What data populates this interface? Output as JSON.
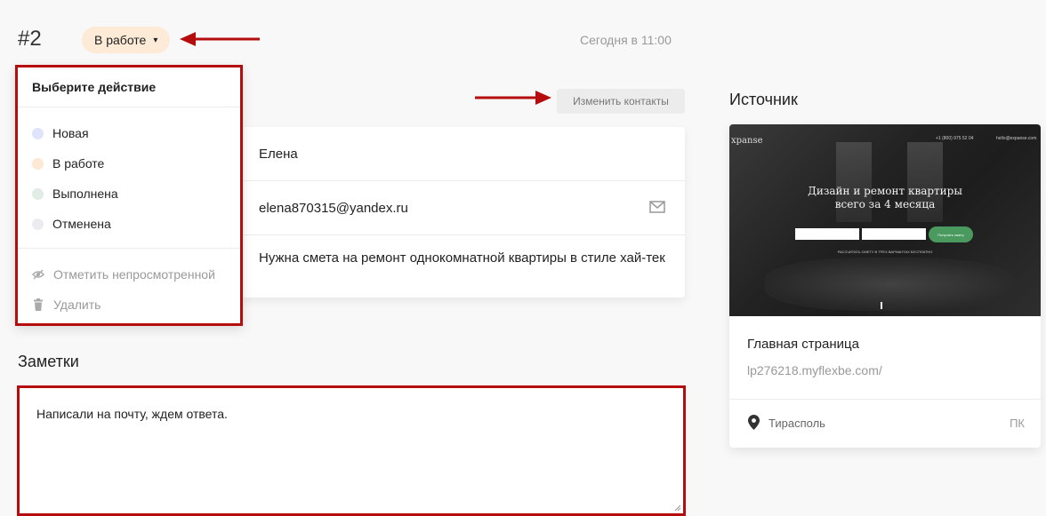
{
  "header": {
    "order_id": "#2",
    "status": "В работе",
    "timestamp": "Сегодня в 11:00"
  },
  "contacts": {
    "change_button": "Изменить контакты",
    "name": "Елена",
    "email": "elena870315@yandex.ru",
    "message": "Нужна смета на ремонт однокомнатной квартиры в стиле хай-тек"
  },
  "dropdown": {
    "title": "Выберите действие",
    "statuses": [
      {
        "label": "Новая",
        "color": "#dfe3fb"
      },
      {
        "label": "В работе",
        "color": "#fde8d3"
      },
      {
        "label": "Выполнена",
        "color": "#e0ece4"
      },
      {
        "label": "Отменена",
        "color": "#ececf0"
      }
    ],
    "actions": [
      {
        "label": "Отметить непросмотренной",
        "icon": "eye-off-icon"
      },
      {
        "label": "Удалить",
        "icon": "trash-icon"
      }
    ]
  },
  "notes": {
    "label": "Заметки",
    "text": "Написали на почту, ждем ответа."
  },
  "source": {
    "label": "Источник",
    "preview": {
      "logo": "xpanse",
      "phone": "+1 (800) 975 52 04",
      "email": "hello@expanse.com",
      "headline_1": "Дизайн и ремонт квартиры",
      "headline_2": "всего за 4 месяца",
      "cta": "Получить смету",
      "subtext": "РАССЧИТАТЬ СМЕТУ В ТРЕХ ВАРИАНТАХ БЕСПЛАТНО"
    },
    "page_title": "Главная страница",
    "page_url": "lp276218.myflexbe.com/",
    "city": "Тирасполь",
    "device": "ПК"
  },
  "colors": {
    "annotation_red": "#b50d0d",
    "status_pill_bg": "#fdebd8"
  }
}
